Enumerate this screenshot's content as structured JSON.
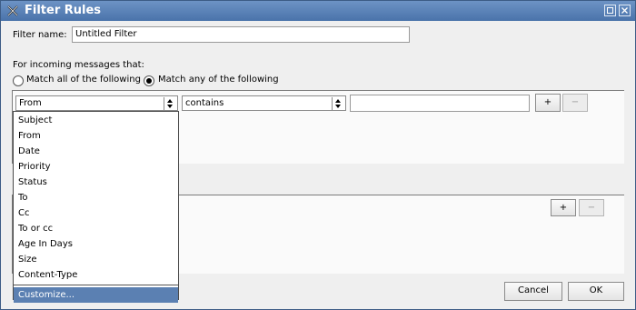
{
  "window": {
    "title": "Filter Rules"
  },
  "filter_name": {
    "label": "Filter name:",
    "value": "Untitled Filter"
  },
  "incoming": {
    "label": "For incoming messages that:",
    "match_all": "Match all of the following",
    "match_any": "Match any of the following",
    "selected": "any"
  },
  "rule": {
    "field": "From",
    "operator": "contains",
    "value": "",
    "add_label": "+",
    "remove_label": "−"
  },
  "actions": {
    "add_label": "+",
    "remove_label": "−"
  },
  "dropdown": {
    "items": [
      "Subject",
      "From",
      "Date",
      "Priority",
      "Status",
      "To",
      "Cc",
      "To or cc",
      "Age In Days",
      "Size",
      "Content-Type"
    ],
    "customize": "Customize..."
  },
  "buttons": {
    "cancel": "Cancel",
    "ok": "OK"
  }
}
